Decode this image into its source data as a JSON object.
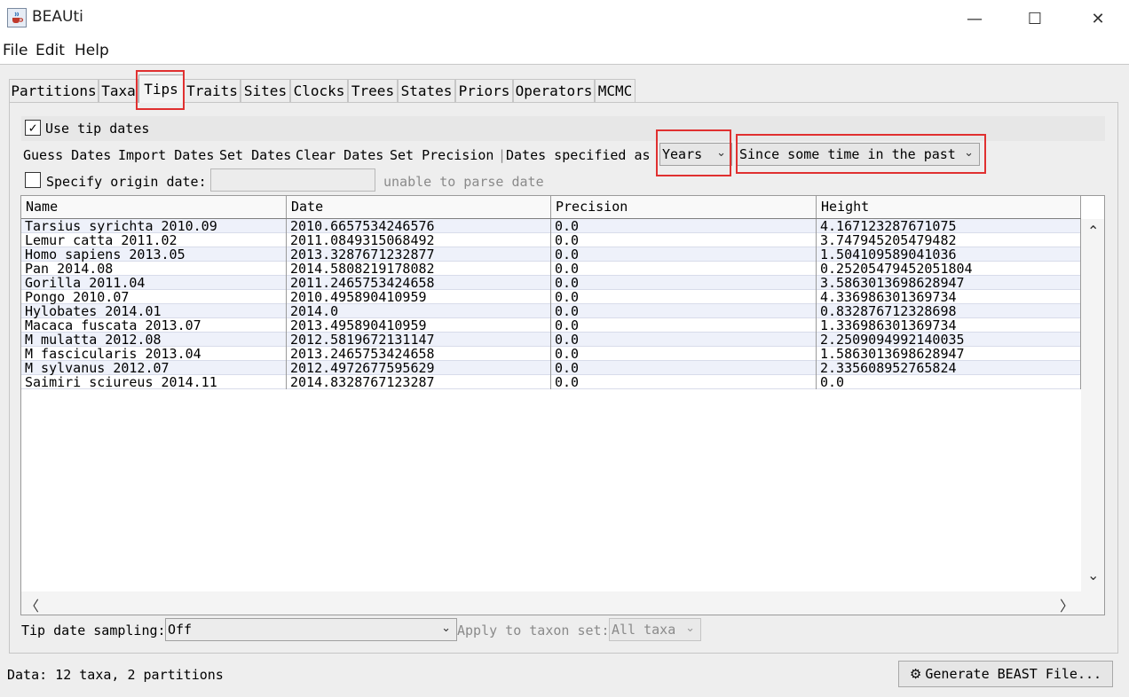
{
  "window": {
    "title": "BEAUti",
    "minimize": "—",
    "maximize": "☐",
    "close": "✕"
  },
  "menubar": [
    "File",
    "Edit",
    "Help"
  ],
  "tabs": [
    "Partitions",
    "Taxa",
    "Tips",
    "Traits",
    "Sites",
    "Clocks",
    "Trees",
    "States",
    "Priors",
    "Operators",
    "MCMC"
  ],
  "active_tab": "Tips",
  "tips": {
    "use_tip_dates": {
      "label": "Use tip dates",
      "checked": true,
      "mark": "✓"
    },
    "actions": [
      "Guess Dates",
      "Import Dates",
      "Set Dates",
      "Clear Dates",
      "Set Precision"
    ],
    "separator": "|",
    "dates_specified_label": "Dates specified as",
    "units": {
      "value": "Years"
    },
    "direction": {
      "value": "Since some time in the past"
    },
    "origin": {
      "label": "Specify origin date:",
      "checked": false,
      "value": "",
      "message": "unable to parse date"
    },
    "table": {
      "columns": [
        "Name",
        "Date",
        "Precision",
        "Height"
      ],
      "rows": [
        [
          "Tarsius syrichta 2010.09",
          "2010.6657534246576",
          "0.0",
          "4.167123287671075"
        ],
        [
          "Lemur catta 2011.02",
          "2011.0849315068492",
          "0.0",
          "3.747945205479482"
        ],
        [
          "Homo sapiens 2013.05",
          "2013.3287671232877",
          "0.0",
          "1.504109589041036"
        ],
        [
          "Pan 2014.08",
          "2014.5808219178082",
          "0.0",
          "0.25205479452051804"
        ],
        [
          "Gorilla 2011.04",
          "2011.2465753424658",
          "0.0",
          "3.5863013698628947"
        ],
        [
          "Pongo 2010.07",
          "2010.495890410959",
          "0.0",
          "4.336986301369734"
        ],
        [
          "Hylobates 2014.01",
          "2014.0",
          "0.0",
          "0.832876712328698"
        ],
        [
          "Macaca fuscata 2013.07",
          "2013.495890410959",
          "0.0",
          "1.336986301369734"
        ],
        [
          "M mulatta 2012.08",
          "2012.5819672131147",
          "0.0",
          "2.2509094992140035"
        ],
        [
          "M fascicularis 2013.04",
          "2013.2465753424658",
          "0.0",
          "1.5863013698628947"
        ],
        [
          "M sylvanus 2012.07",
          "2012.4972677595629",
          "0.0",
          "2.335608952765824"
        ],
        [
          "Saimiri sciureus 2014.11",
          "2014.8328767123287",
          "0.0",
          "0.0"
        ]
      ],
      "scroll_up": "⌃",
      "scroll_down": "⌄",
      "scroll_left": "〈",
      "scroll_right": "〉"
    },
    "tip_date_sampling": {
      "label": "Tip date sampling:",
      "value": "Off"
    },
    "apply_to_taxon": {
      "label": "Apply to taxon set:",
      "value": "All taxa"
    }
  },
  "status": "Data: 12 taxa, 2 partitions",
  "generate_button": {
    "icon": "⚙",
    "label": "Generate BEAST File..."
  }
}
